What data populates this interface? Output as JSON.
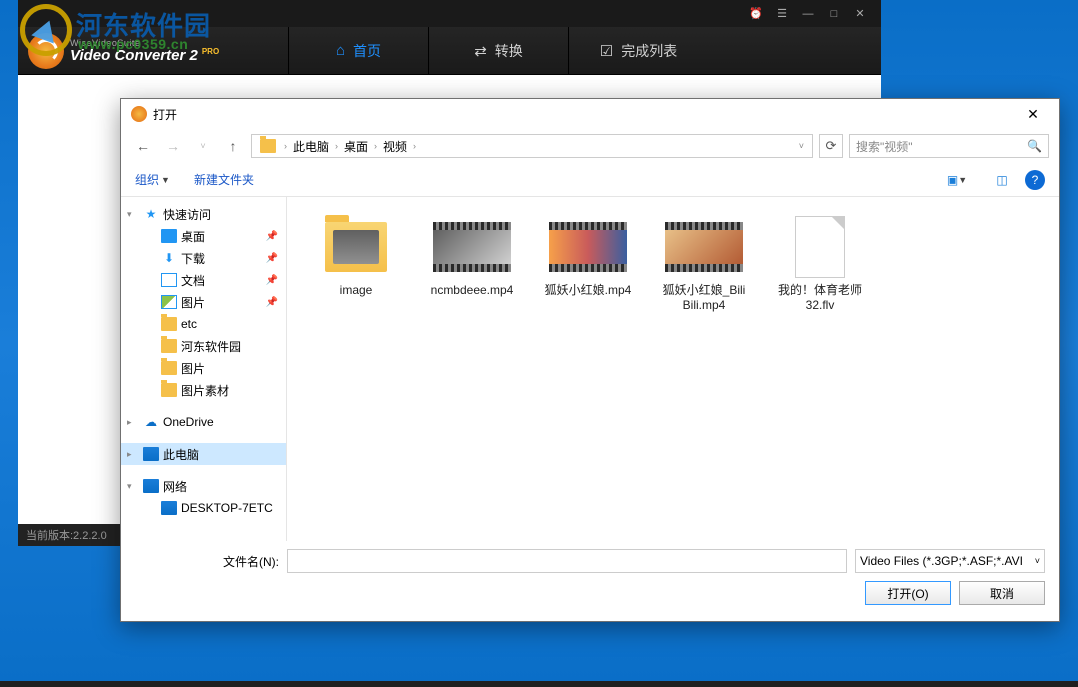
{
  "app": {
    "suite_line": "WiseVideoSuite",
    "title_line": "Video Converter 2",
    "pro": "PRO",
    "site_url": "www.pc0359.cn",
    "tabs": {
      "home": "首页",
      "convert": "转换",
      "done": "完成列表"
    },
    "status": "当前版本:2.2.2.0"
  },
  "watermark": {
    "text": "河东软件园",
    "url": "www.pc0359.cn"
  },
  "dialog": {
    "title": "打开",
    "breadcrumb": [
      "此电脑",
      "桌面",
      "视频"
    ],
    "search_placeholder": "搜索\"视频\"",
    "toolbar": {
      "organize": "组织",
      "newfolder": "新建文件夹"
    },
    "sidebar": {
      "quick": "快速访问",
      "desktop": "桌面",
      "downloads": "下载",
      "documents": "文档",
      "pictures": "图片",
      "etc": "etc",
      "hedong": "河东软件园",
      "pics2": "图片",
      "pics_material": "图片素材",
      "onedrive": "OneDrive",
      "thispc": "此电脑",
      "network": "网络",
      "desktop_pc": "DESKTOP-7ETC"
    },
    "files": [
      {
        "name": "image",
        "type": "folder"
      },
      {
        "name": "ncmbdeee.mp4",
        "type": "video",
        "cls": "tv1"
      },
      {
        "name": "狐妖小红娘.mp4",
        "type": "video",
        "cls": "tv2"
      },
      {
        "name": "狐妖小红娘_BiliBili.mp4",
        "type": "video",
        "cls": "tv3"
      },
      {
        "name": "我的！体育老师32.flv",
        "type": "file"
      }
    ],
    "filename_label": "文件名(N):",
    "filename_value": "",
    "filter": "Video Files (*.3GP;*.ASF;*.AVI",
    "open_btn": "打开(O)",
    "cancel_btn": "取消"
  }
}
